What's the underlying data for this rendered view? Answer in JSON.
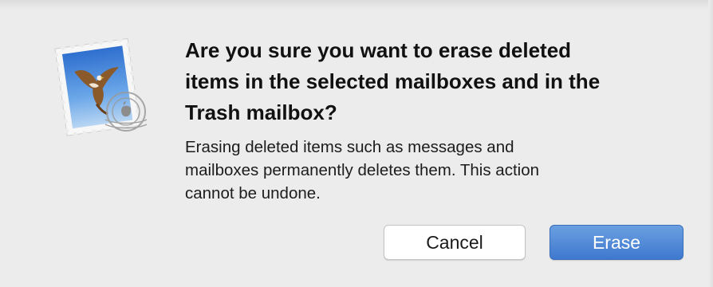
{
  "dialog": {
    "icon": "mail-stamp-icon",
    "title": "Are you sure you want to erase deleted\nitems in the selected mailboxes and in the\nTrash mailbox?",
    "message": "Erasing deleted items such as messages and\nmailboxes permanently deletes them. This action\ncannot be undone.",
    "buttons": {
      "cancel_label": "Cancel",
      "erase_label": "Erase"
    }
  },
  "colors": {
    "background": "#ececec",
    "primary_button": "#4a84d6",
    "secondary_button": "#ffffff"
  }
}
